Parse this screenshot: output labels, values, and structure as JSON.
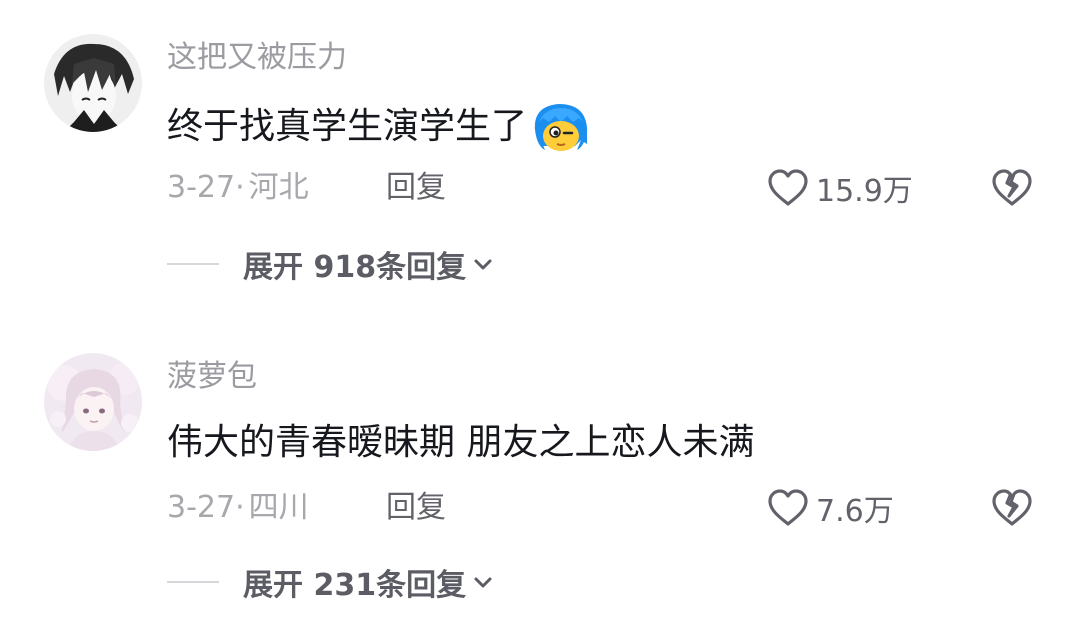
{
  "comments": [
    {
      "username": "这把又被压力",
      "text": "终于找真学生演学生了",
      "emoji": "blue-haired-character-emoji",
      "date": "3-27",
      "separator": "·",
      "location": "河北",
      "reply_label": "回复",
      "like_count": "15.9万",
      "expand_label": "展开 918条回复"
    },
    {
      "username": "菠萝包",
      "text": "伟大的青春暧昧期 朋友之上恋人未满",
      "date": "3-27",
      "separator": "·",
      "location": "四川",
      "reply_label": "回复",
      "like_count": "7.6万",
      "expand_label": "展开 231条回复"
    }
  ],
  "icons": {
    "like": "heart-outline-icon",
    "dislike": "broken-heart-icon",
    "expand": "chevron-down-icon"
  },
  "colors": {
    "username": "#9b9ba1",
    "text": "#16181d",
    "meta": "#a7a7ac",
    "action": "#62636a"
  }
}
